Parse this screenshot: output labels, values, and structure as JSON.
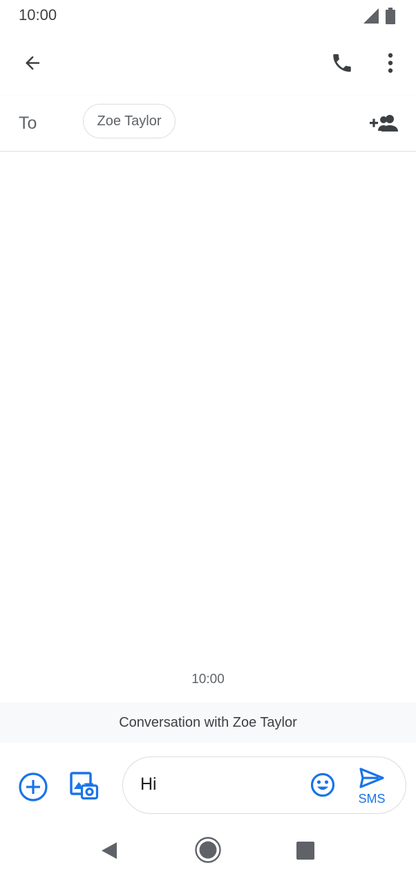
{
  "status_bar": {
    "time": "10:00",
    "icons": [
      "signal-icon",
      "battery-icon"
    ]
  },
  "app_bar": {
    "icons": [
      "back-arrow-icon",
      "phone-icon",
      "more-vert-icon"
    ]
  },
  "recipients": {
    "to_label": "To",
    "chips": [
      {
        "name": "Zoe Taylor"
      }
    ],
    "add_icon": "add-people-icon"
  },
  "messages": {
    "timestamp": "10:00",
    "banner": "Conversation with Zoe Taylor"
  },
  "compose": {
    "text": "Hi",
    "send_label": "SMS",
    "icons": [
      "add-circle-icon",
      "gallery-camera-icon",
      "emoji-icon",
      "send-icon"
    ]
  },
  "nav": {
    "icons": [
      "nav-back-icon",
      "nav-home-icon",
      "nav-recents-icon"
    ]
  },
  "colors": {
    "accent": "#1a73e8",
    "icon_dark": "#3c4043",
    "text_secondary": "#5f6368",
    "banner_bg": "#f8f9fa"
  }
}
